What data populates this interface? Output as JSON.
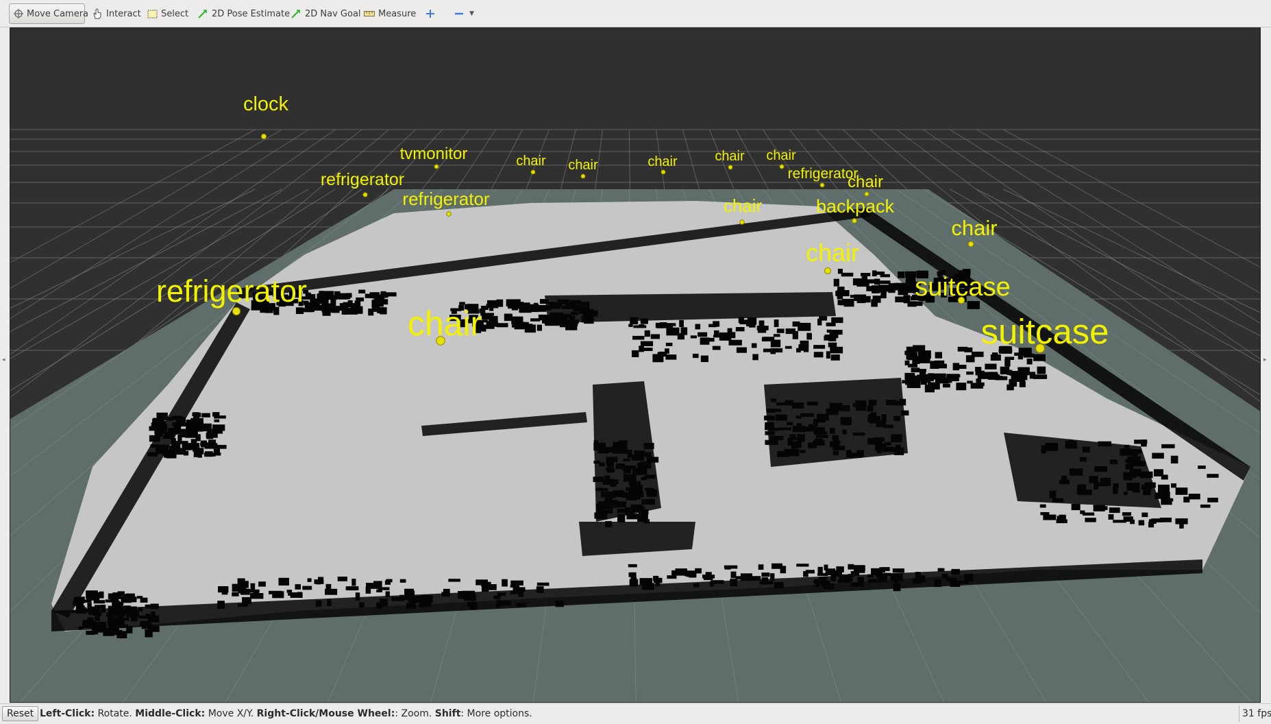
{
  "toolbar": {
    "tools": [
      {
        "label": "Move Camera",
        "icon": "move-camera-icon",
        "active": true
      },
      {
        "label": "Interact",
        "icon": "hand-icon"
      },
      {
        "label": "Select",
        "icon": "select-box-icon"
      },
      {
        "label": "2D Pose Estimate",
        "icon": "green-arrow-icon"
      },
      {
        "label": "2D Nav Goal",
        "icon": "green-arrow-icon"
      },
      {
        "label": "Measure",
        "icon": "ruler-icon"
      }
    ],
    "add_tool_icon": "plus-icon",
    "remove_tool_icon": "minus-icon"
  },
  "viewport": {
    "background_color": "#303030",
    "grid_color": "#8c8c8c",
    "map_free_color": "#c6c6c6",
    "map_unknown_color": "#5f6d6b",
    "map_occupied_color": "#050505",
    "label_color": "#f2f200",
    "object_labels": [
      "clock",
      "tvmonitor",
      "chair",
      "chair",
      "chair",
      "chair",
      "chair",
      "refrigerator",
      "refrigerator",
      "chair",
      "refrigerator",
      "chair",
      "backpack",
      "chair",
      "chair",
      "refrigerator",
      "suitcase",
      "chair",
      "suitcase"
    ]
  },
  "statusbar": {
    "reset_label": "Reset",
    "hint": [
      {
        "bold": "Left-Click:",
        "text": " Rotate. "
      },
      {
        "bold": "Middle-Click:",
        "text": " Move X/Y. "
      },
      {
        "bold": "Right-Click/Mouse Wheel:",
        "text": ": Zoom. "
      },
      {
        "bold": "Shift",
        "text": ": More options."
      }
    ],
    "fps": "31 fps"
  }
}
